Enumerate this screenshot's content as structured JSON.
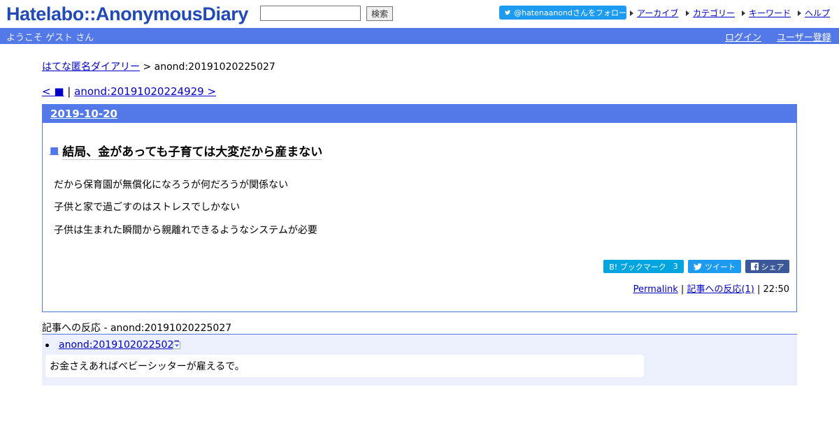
{
  "header": {
    "logo": "Hatelabo::AnonymousDiary",
    "search": {
      "value": "",
      "placeholder": "",
      "button": "検索"
    },
    "follow_button": "@hatenaanondさんをフォロー",
    "links": [
      "アーカイブ",
      "カテゴリー",
      "キーワード",
      "ヘルプ"
    ]
  },
  "bar": {
    "welcome": "ようこそ ゲスト さん",
    "login": "ログイン",
    "register": "ユーザー登録"
  },
  "breadcrumb": {
    "home": "はてな匿名ダイアリー",
    "separator": ">",
    "current": "anond:20191020225027"
  },
  "pager": {
    "prev": "< ■",
    "separator": "|",
    "next": "anond:20191020224929 >"
  },
  "article": {
    "date": "2019-10-20",
    "title_marker": "■",
    "title": "結局、金があっても子育ては大変だから産まない",
    "body_lines": [
      "だから保育園が無償化になろうが何だろうが関係ない",
      "子供と家で過ごすのはストレスでしかない",
      "子供は生まれた瞬間から親離れできるようなシステムが必要"
    ],
    "share": {
      "bookmark": "B! ブックマーク",
      "bookmark_count": "3",
      "tweet": "ツイート",
      "facebook": "シェア"
    },
    "footer": {
      "permalink": "Permalink",
      "separator": "|",
      "reactions": "記事への反応(1)",
      "time": "22:50"
    }
  },
  "reactions": {
    "title": "記事への反応 - anond:20191020225027",
    "items": [
      {
        "link": "anond:20191020225027",
        "body": "お金さえあればベビーシッターが雇えるで。"
      }
    ]
  },
  "colors": {
    "brand": "#5279e7",
    "logo": "#2249b8",
    "twitter": "#1d9bf0",
    "hatena": "#00a4de",
    "facebook": "#3b5998"
  }
}
